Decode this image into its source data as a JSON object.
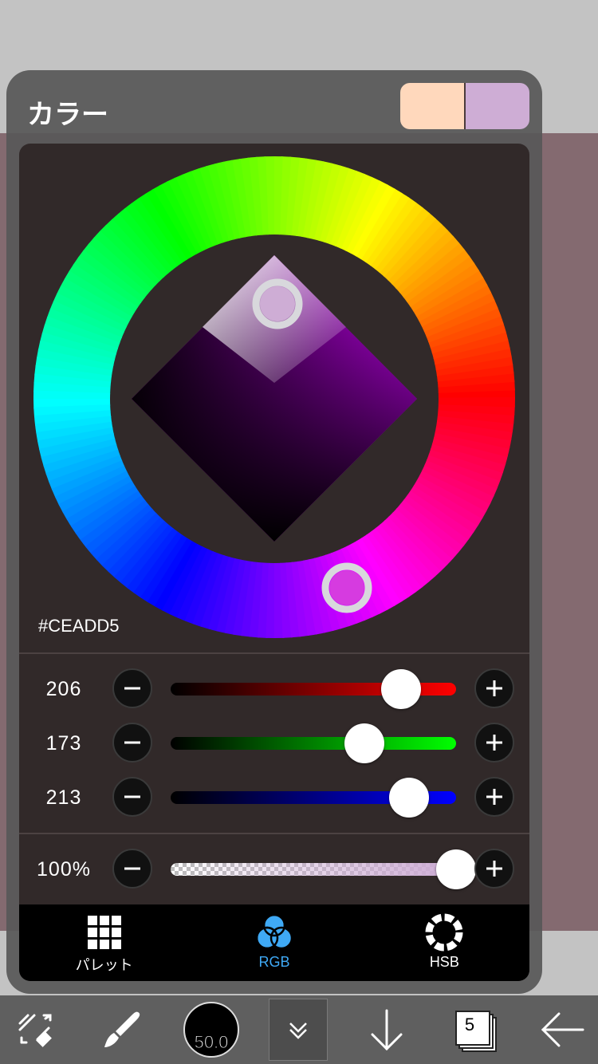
{
  "panel": {
    "title": "カラー",
    "swatches": {
      "primary": "#FFD8BC",
      "secondary": "#CEADD5"
    }
  },
  "color": {
    "hex_label": "#CEADD5",
    "current": "#CEADD5",
    "hue_marker_color": "#D63BE0",
    "sv_marker_color": "#CEADD5"
  },
  "sliders": [
    {
      "channel": "red",
      "value": "206",
      "fraction": 0.808,
      "color": "#FF0000"
    },
    {
      "channel": "green",
      "value": "173",
      "fraction": 0.678,
      "color": "#00FF00"
    },
    {
      "channel": "blue",
      "value": "213",
      "fraction": 0.835,
      "color": "#0000FF"
    }
  ],
  "opacity": {
    "value": "100%",
    "fraction": 1.0
  },
  "tabs": [
    {
      "label": "パレット",
      "icon": "palette-grid-icon",
      "active": false
    },
    {
      "label": "RGB",
      "icon": "rgb-circles-icon",
      "active": true
    },
    {
      "label": "HSB",
      "icon": "hsb-ring-icon",
      "active": false
    }
  ],
  "toolbar": {
    "brush_size": "50.0",
    "layer_count": "5",
    "icons": [
      "transform-tool-icon",
      "brush-icon",
      "brush-size-icon",
      "menu-chevron-icon",
      "arrow-down-icon",
      "layers-icon",
      "back-arrow-icon"
    ]
  },
  "colors": {
    "accent": "#3FA9F5",
    "panel_bg": "#585858",
    "inner_bg": "#2E2626",
    "canvas_bg": "#846A70"
  }
}
